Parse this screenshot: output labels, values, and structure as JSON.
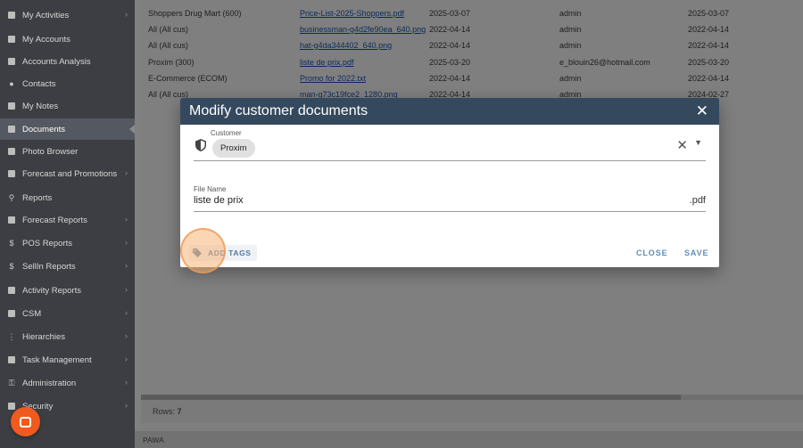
{
  "sidebar": {
    "items": [
      {
        "label": "My Activities",
        "icon": "calendar-icon",
        "chevron": true
      },
      {
        "label": "My Accounts",
        "icon": "building-icon",
        "chevron": false
      },
      {
        "label": "Accounts Analysis",
        "icon": "analysis-icon",
        "chevron": false
      },
      {
        "label": "Contacts",
        "icon": "person-icon",
        "chevron": false
      },
      {
        "label": "My Notes",
        "icon": "note-icon",
        "chevron": false
      },
      {
        "label": "Documents",
        "icon": "documents-icon",
        "chevron": false,
        "active": true
      },
      {
        "label": "Photo Browser",
        "icon": "image-icon",
        "chevron": false
      },
      {
        "label": "Forecast and Promotions",
        "icon": "forecast-icon",
        "chevron": true
      },
      {
        "label": "Reports",
        "icon": "search-icon",
        "chevron": false
      },
      {
        "label": "Forecast Reports",
        "icon": "report-icon",
        "chevron": true
      },
      {
        "label": "POS Reports",
        "icon": "dollar-icon",
        "chevron": true
      },
      {
        "label": "SellIn Reports",
        "icon": "dollar-icon",
        "chevron": true
      },
      {
        "label": "Activity Reports",
        "icon": "cube-icon",
        "chevron": true
      },
      {
        "label": "CSM",
        "icon": "list-icon",
        "chevron": true
      },
      {
        "label": "Hierarchies",
        "icon": "hierarchy-icon",
        "chevron": true
      },
      {
        "label": "Task Management",
        "icon": "task-icon",
        "chevron": true
      },
      {
        "label": "Administration",
        "icon": "key-icon",
        "chevron": true
      },
      {
        "label": "Security",
        "icon": "lock-icon",
        "chevron": true
      }
    ]
  },
  "grid": {
    "rows": [
      {
        "customer": "Shoppers Drug Mart (600)",
        "file": "Price-List-2025-Shoppers.pdf",
        "date": "2025-03-07",
        "user": "admin",
        "modified": "2025-03-07"
      },
      {
        "customer": "All (All cus)",
        "file": "businessman-g4d2fe90ea_640.png",
        "date": "2022-04-14",
        "user": "admin",
        "modified": "2022-04-14"
      },
      {
        "customer": "All (All cus)",
        "file": "hat-g4da344402_640.png",
        "date": "2022-04-14",
        "user": "admin",
        "modified": "2022-04-14"
      },
      {
        "customer": "Proxim (300)",
        "file": "liste de prix.pdf",
        "date": "2025-03-20",
        "user": "e_blouin26@hotmail.com",
        "modified": "2025-03-20"
      },
      {
        "customer": "E-Commerce (ECOM)",
        "file": "Promo for 2022.txt",
        "date": "2022-04-14",
        "user": "admin",
        "modified": "2022-04-14"
      },
      {
        "customer": "All (All cus)",
        "file": "man-g73c19fce2_1280.png",
        "date": "2022-04-14",
        "user": "admin",
        "modified": "2024-02-27"
      }
    ],
    "rows_label": "Rows:",
    "rows_count": "7"
  },
  "footer": {
    "text": "PAWA"
  },
  "modal": {
    "title": "Modify customer documents",
    "customer_label": "Customer",
    "customer_chip": "Proxim",
    "file_label": "File Name",
    "file_value": "liste de prix",
    "file_ext": ".pdf",
    "add_tags_label": "ADD TAGS",
    "close_label": "CLOSE",
    "save_label": "SAVE"
  },
  "colors": {
    "header": "#35495e",
    "accent": "#5f8fb4",
    "chat": "#f05a1e"
  }
}
